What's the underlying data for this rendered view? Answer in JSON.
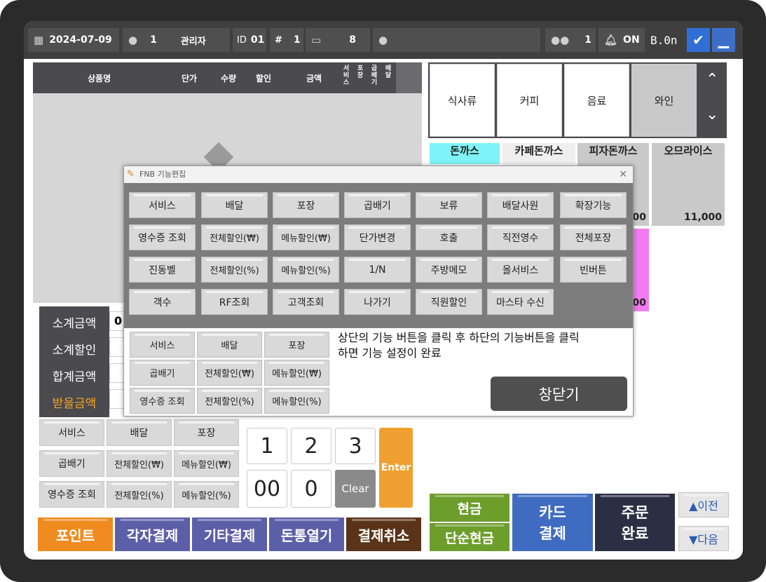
{
  "topbar": {
    "date": "2024-07-09",
    "user_no": "1",
    "user_role": "관리자",
    "id_label": "ID",
    "id_value": "01",
    "hash_label": "#",
    "hash_value": "1",
    "terminal_value": "8",
    "guest_count": "1",
    "alarm_status": "ON",
    "version": "B.0n"
  },
  "order_list": {
    "headers": [
      "상품명",
      "단가",
      "수량",
      "할인",
      "금액"
    ],
    "flags": [
      "서비스",
      "포장",
      "곱배기",
      "배달"
    ]
  },
  "summary": {
    "labels": [
      "소계금액",
      "소계할인",
      "합계금액",
      "받을금액"
    ],
    "subtotal_value": "0",
    "label_color_due": "#f5a623"
  },
  "function_buttons": [
    "서비스",
    "배달",
    "포장",
    "곱배기",
    "전체할인(₩)",
    "메뉴할인(₩)",
    "영수증 조회",
    "전체할인(%)",
    "메뉴할인(%)"
  ],
  "numpad": {
    "keys": [
      "1",
      "2",
      "3",
      "00",
      "0"
    ],
    "clear": "Clear",
    "enter": "Enter"
  },
  "bottom_buttons": [
    "포인트",
    "각자결제",
    "기타결제",
    "돈통열기",
    "결제취소"
  ],
  "payment": {
    "cash": "현금",
    "simple_cash": "단순현금",
    "card_line1": "카드",
    "card_line2": "결제",
    "order_line1": "주문",
    "order_line2": "완료",
    "prev": "▲이전",
    "next": "▼다음"
  },
  "categories": [
    "식사류",
    "커피",
    "음료",
    "와인"
  ],
  "menu_items": [
    {
      "name": "돈까스",
      "price": ""
    },
    {
      "name": "카페돈까스",
      "price": ""
    },
    {
      "name": "피자돈까스",
      "price": "000"
    },
    {
      "name": "오므라이스",
      "price": "11,000"
    }
  ],
  "menu_partial_price": "000",
  "dialog": {
    "title": "FNB 기능편집",
    "grid": [
      [
        "서비스",
        "배달",
        "포장",
        "곱배기",
        "보류",
        "배달사원",
        "확장기능"
      ],
      [
        "영수증 조회",
        "전체할인(₩)",
        "메뉴할인(₩)",
        "단가변경",
        "호출",
        "직전영수",
        "전체포장"
      ],
      [
        "진동벨",
        "전체할인(%)",
        "메뉴할인(%)",
        "1/N",
        "주방메모",
        "올서비스",
        "빈버튼"
      ],
      [
        "객수",
        "RF조회",
        "고객조회",
        "나가기",
        "직원할인",
        "마스타 수신"
      ]
    ],
    "selected": [
      "서비스",
      "배달",
      "포장",
      "곱배기",
      "전체할인(₩)",
      "메뉴할인(₩)",
      "영수증 조회",
      "전체할인(%)",
      "메뉴할인(%)"
    ],
    "message_line1": "상단의 기능 버튼을 클릭 후 하단의 기능버튼을 클릭",
    "message_line2": "하면 기능 설정이 완료",
    "close_label": "창닫기"
  }
}
